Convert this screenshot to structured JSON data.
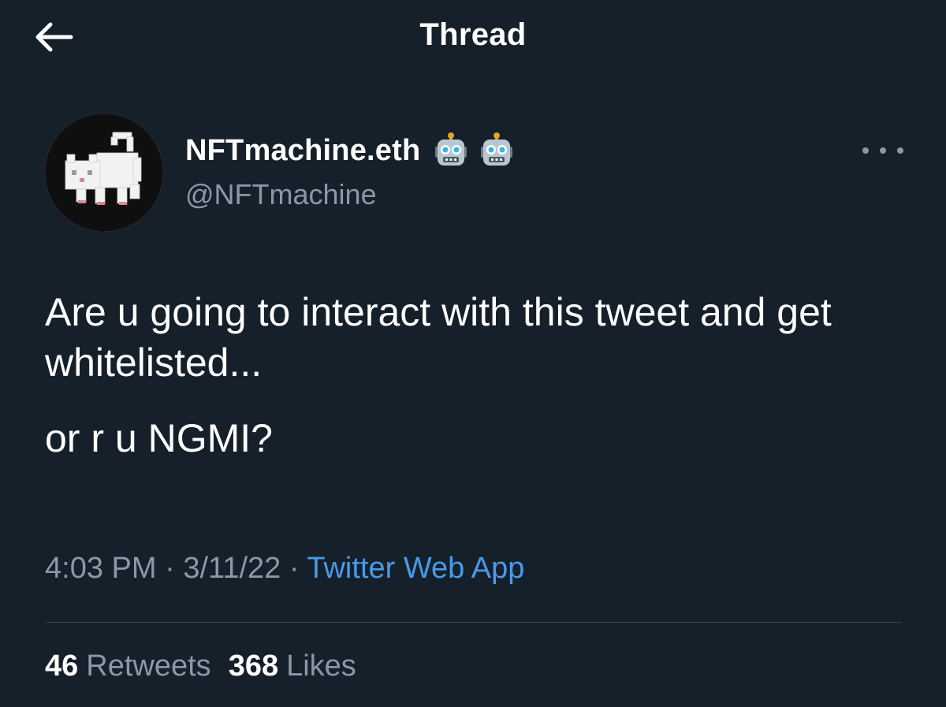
{
  "header": {
    "title": "Thread",
    "back_icon": "arrow-left-icon"
  },
  "author": {
    "display_name": "NFTmachine.eth",
    "handle": "@NFTmachine",
    "badges": [
      "robot-icon",
      "robot-icon"
    ],
    "avatar": "pixel-cat-avatar"
  },
  "tweet": {
    "paragraphs": [
      "Are u going to interact with this tweet and get whitelisted...",
      "or r u NGMI?"
    ],
    "time": "4:03 PM",
    "date": "3/11/22",
    "separator": "·",
    "source": "Twitter Web App"
  },
  "stats": {
    "retweets_count": "46",
    "retweets_label": "Retweets",
    "likes_count": "368",
    "likes_label": "Likes"
  },
  "colors": {
    "background": "#15202b",
    "text": "#ffffff",
    "secondary": "#8b98a5",
    "link": "#4a99e9",
    "divider": "#38444d"
  }
}
